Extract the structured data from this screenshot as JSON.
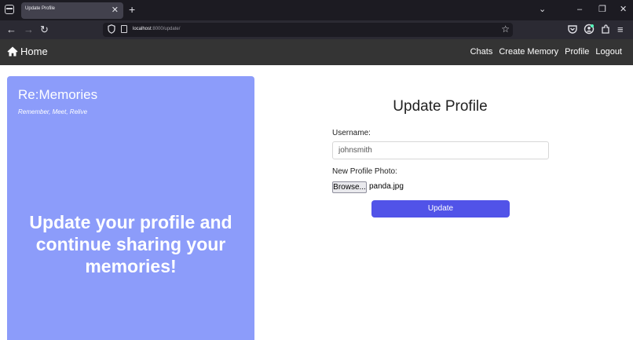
{
  "browser": {
    "tab_title": "Update Profile",
    "tab_close": "✕",
    "new_tab": "+",
    "list_all_tabs": "⌄",
    "minimize": "–",
    "restore": "❐",
    "close": "✕",
    "back": "←",
    "forward": "→",
    "reload": "↻",
    "url_host": "localhost",
    "url_rest": ":8000/update/",
    "bookmark": "☆",
    "menu": "≡"
  },
  "site_nav": {
    "home_label": "Home",
    "links": [
      "Chats",
      "Create Memory",
      "Profile",
      "Logout"
    ]
  },
  "hero": {
    "title": "Re:Memories",
    "tagline": "Remember, Meet, Relive",
    "message": "Update your profile and continue sharing your memories!"
  },
  "form": {
    "title": "Update Profile",
    "username_label": "Username:",
    "username_value": "johnsmith",
    "photo_label": "New Profile Photo:",
    "browse_label": "Browse...",
    "file_name": "panda.jpg",
    "submit_label": "Update"
  },
  "colors": {
    "hero_bg": "#8c9cfa",
    "button_bg": "#5153e8",
    "site_nav_bg": "#343434"
  }
}
